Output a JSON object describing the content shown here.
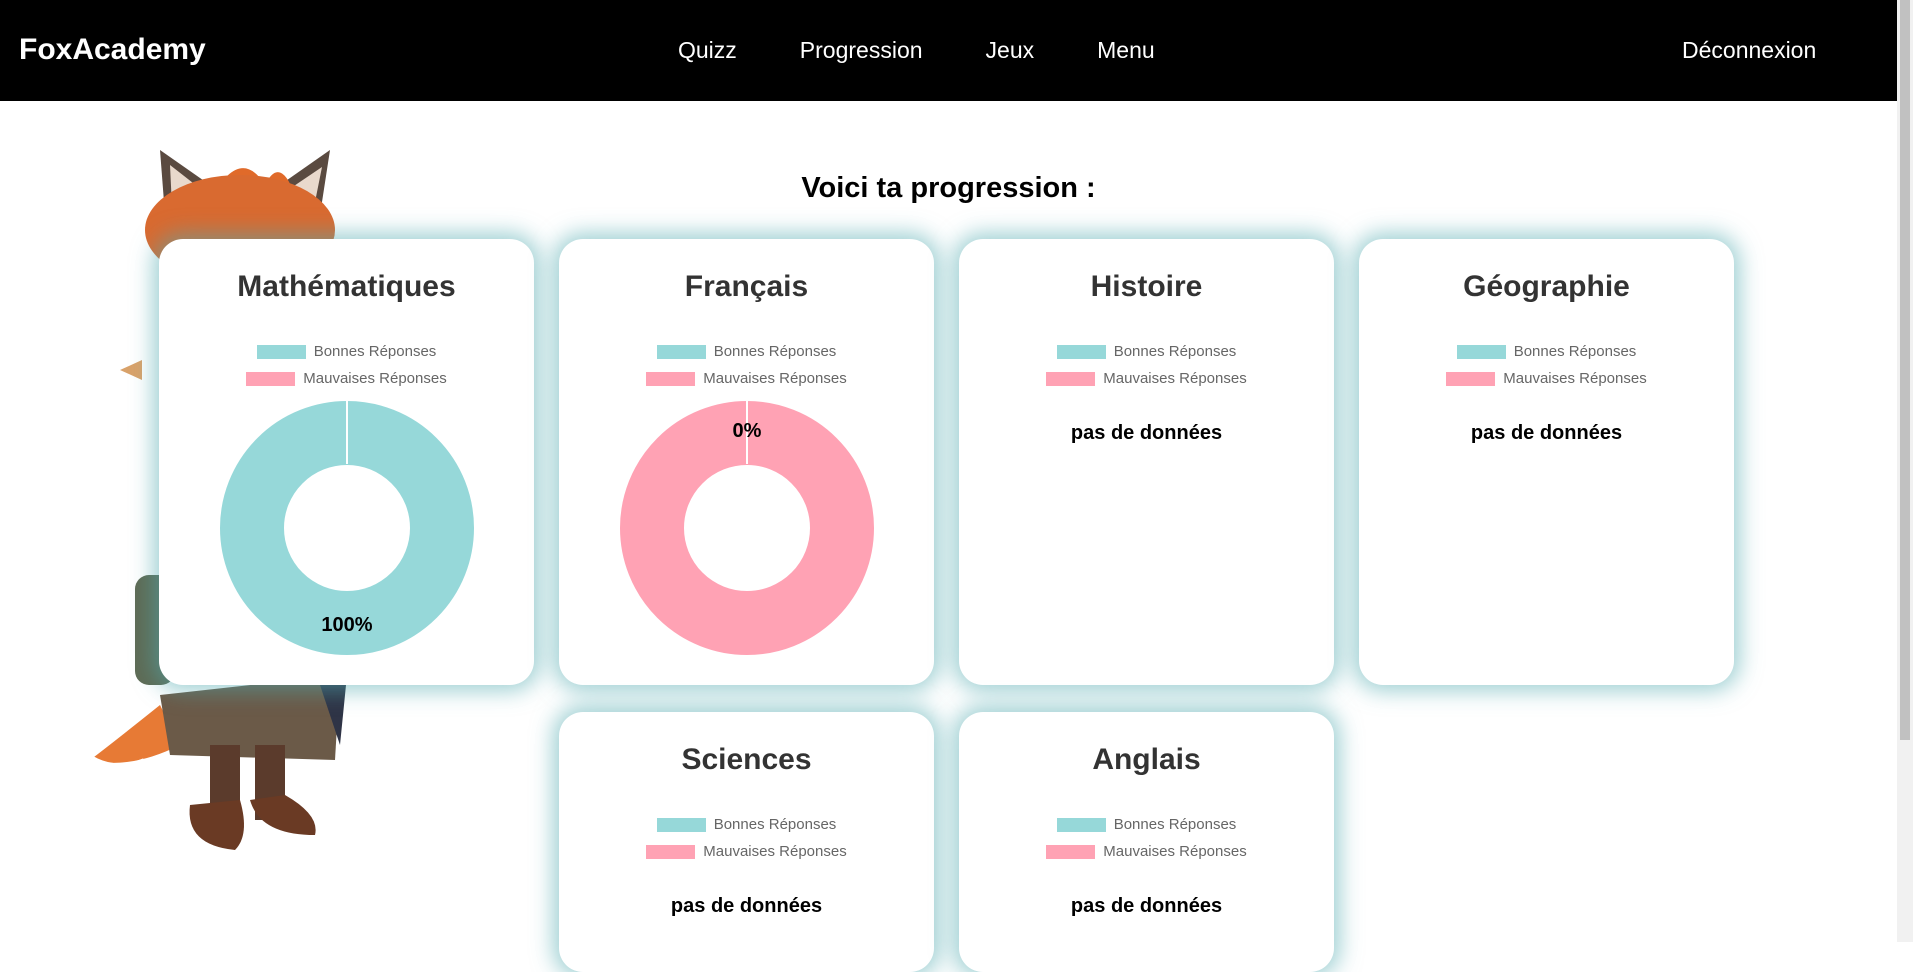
{
  "app": {
    "brand": "FoxAcademy",
    "nav": [
      "Quizz",
      "Progression",
      "Jeux",
      "Menu"
    ],
    "logout": "Déconnexion"
  },
  "page": {
    "title": "Voici ta progression :"
  },
  "legend": {
    "good": "Bonnes Réponses",
    "bad": "Mauvaises Réponses"
  },
  "colors": {
    "good": "#96d8d9",
    "bad": "#ffa2b4"
  },
  "subjects": [
    {
      "name": "Mathématiques",
      "has_data": true,
      "good_pct": 100,
      "label": "100%"
    },
    {
      "name": "Français",
      "has_data": true,
      "good_pct": 0,
      "label": "0%"
    },
    {
      "name": "Histoire",
      "has_data": false,
      "nodata": "pas de données"
    },
    {
      "name": "Géographie",
      "has_data": false,
      "nodata": "pas de données"
    },
    {
      "name": "Sciences",
      "has_data": false,
      "nodata": "pas de données"
    },
    {
      "name": "Anglais",
      "has_data": false,
      "nodata": "pas de données"
    }
  ]
}
